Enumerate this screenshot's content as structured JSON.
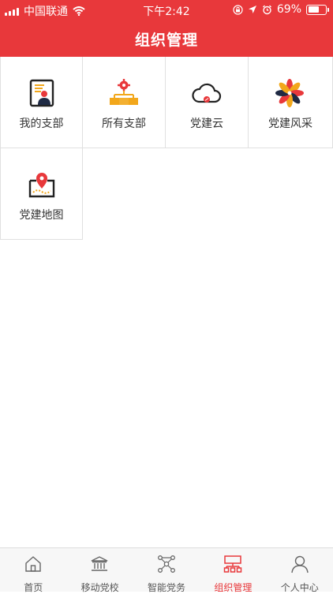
{
  "status_bar": {
    "carrier": "中国联通",
    "time": "下午2:42",
    "battery_text": "69%",
    "battery_level": 0.69
  },
  "header": {
    "title": "组织管理"
  },
  "grid": {
    "items": [
      {
        "label": "我的支部",
        "icon": "member-card-icon"
      },
      {
        "label": "所有支部",
        "icon": "org-chart-icon"
      },
      {
        "label": "党建云",
        "icon": "cloud-party-icon"
      },
      {
        "label": "党建风采",
        "icon": "flower-petals-icon"
      },
      {
        "label": "党建地图",
        "icon": "map-pin-icon"
      }
    ]
  },
  "tabbar": {
    "tabs": [
      {
        "label": "首页",
        "icon": "home-icon",
        "active": false
      },
      {
        "label": "移动党校",
        "icon": "building-icon",
        "active": false
      },
      {
        "label": "智能党务",
        "icon": "network-icon",
        "active": false
      },
      {
        "label": "组织管理",
        "icon": "org-structure-icon",
        "active": true
      },
      {
        "label": "个人中心",
        "icon": "person-icon",
        "active": false
      }
    ]
  },
  "colors": {
    "brand": "#e8383b",
    "accent_orange": "#f2a71b",
    "text": "#333333"
  }
}
